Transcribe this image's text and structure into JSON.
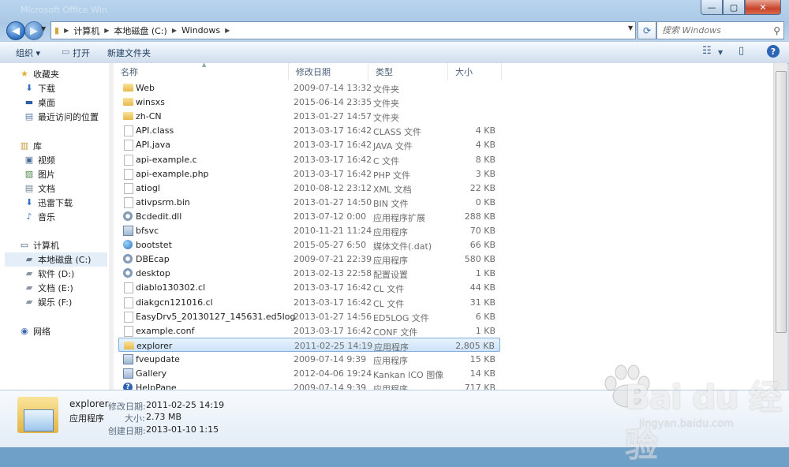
{
  "window": {
    "title_ghost": "Microsoft Office Win",
    "min": "—",
    "max": "▢",
    "close": "✕"
  },
  "address": {
    "segments": [
      "计算机",
      "本地磁盘 (C:)",
      "Windows"
    ]
  },
  "search": {
    "placeholder": "搜索 Windows"
  },
  "toolbar": {
    "organize": "组织 ▾",
    "open": "打开",
    "new_folder": "新建文件夹",
    "help": "?"
  },
  "sidebar": {
    "favorites": "收藏夹",
    "fav_items": [
      "下载",
      "桌面",
      "最近访问的位置"
    ],
    "library": "库",
    "lib_items": [
      "视频",
      "图片",
      "文档",
      "迅雷下载",
      "音乐"
    ],
    "computer": "计算机",
    "drives": [
      "本地磁盘 (C:)",
      "软件 (D:)",
      "文档 (E:)",
      "娱乐 (F:)"
    ],
    "network": "网络"
  },
  "columns": {
    "name": "名称",
    "date": "修改日期",
    "type": "类型",
    "size": "大小"
  },
  "files": [
    {
      "name": "Web",
      "date": "2009-07-14 13:32",
      "type": "文件夹",
      "size": "",
      "icon": "folder"
    },
    {
      "name": "winsxs",
      "date": "2015-06-14 23:35",
      "type": "文件夹",
      "size": "",
      "icon": "folder"
    },
    {
      "name": "zh-CN",
      "date": "2013-01-27 14:57",
      "type": "文件夹",
      "size": "",
      "icon": "folder"
    },
    {
      "name": "API.class",
      "date": "2013-03-17 16:42",
      "type": "CLASS 文件",
      "size": "4 KB",
      "icon": "file"
    },
    {
      "name": "API.java",
      "date": "2013-03-17 16:42",
      "type": "JAVA 文件",
      "size": "4 KB",
      "icon": "file"
    },
    {
      "name": "api-example.c",
      "date": "2013-03-17 16:42",
      "type": "C 文件",
      "size": "8 KB",
      "icon": "file"
    },
    {
      "name": "api-example.php",
      "date": "2013-03-17 16:42",
      "type": "PHP 文件",
      "size": "3 KB",
      "icon": "file"
    },
    {
      "name": "atiogl",
      "date": "2010-08-12 23:12",
      "type": "XML 文档",
      "size": "22 KB",
      "icon": "file"
    },
    {
      "name": "ativpsrm.bin",
      "date": "2013-01-27 14:50",
      "type": "BIN 文件",
      "size": "0 KB",
      "icon": "file"
    },
    {
      "name": "Bcdedit.dll",
      "date": "2013-07-12 0:00",
      "type": "应用程序扩展",
      "size": "288 KB",
      "icon": "gear"
    },
    {
      "name": "bfsvc",
      "date": "2010-11-21 11:24",
      "type": "应用程序",
      "size": "70 KB",
      "icon": "app"
    },
    {
      "name": "bootstet",
      "date": "2015-05-27 6:50",
      "type": "媒体文件(.dat)",
      "size": "66 KB",
      "icon": "globe"
    },
    {
      "name": "DBEcap",
      "date": "2009-07-21 22:39",
      "type": "应用程序",
      "size": "580 KB",
      "icon": "gear"
    },
    {
      "name": "desktop",
      "date": "2013-02-13 22:58",
      "type": "配置设置",
      "size": "1 KB",
      "icon": "gear"
    },
    {
      "name": "diablo130302.cl",
      "date": "2013-03-17 16:42",
      "type": "CL 文件",
      "size": "44 KB",
      "icon": "file"
    },
    {
      "name": "diakgcn121016.cl",
      "date": "2013-03-17 16:42",
      "type": "CL 文件",
      "size": "31 KB",
      "icon": "file"
    },
    {
      "name": "EasyDrv5_20130127_145631.ed5log",
      "date": "2013-01-27 14:56",
      "type": "ED5LOG 文件",
      "size": "6 KB",
      "icon": "file"
    },
    {
      "name": "example.conf",
      "date": "2013-03-17 16:42",
      "type": "CONF 文件",
      "size": "1 KB",
      "icon": "file"
    },
    {
      "name": "explorer",
      "date": "2011-02-25 14:19",
      "type": "应用程序",
      "size": "2,805 KB",
      "icon": "folder",
      "selected": true
    },
    {
      "name": "fveupdate",
      "date": "2009-07-14 9:39",
      "type": "应用程序",
      "size": "15 KB",
      "icon": "app"
    },
    {
      "name": "Gallery",
      "date": "2012-04-06 19:24",
      "type": "Kankan ICO 图像",
      "size": "14 KB",
      "icon": "app"
    },
    {
      "name": "HelpPane",
      "date": "2009-07-14 9:39",
      "type": "应用程序",
      "size": "717 KB",
      "icon": "help"
    }
  ],
  "details": {
    "name": "explorer",
    "type": "应用程序",
    "modified_label": "修改日期:",
    "modified": "2011-02-25 14:19",
    "size_label": "大小:",
    "size": "2.73 MB",
    "created_label": "创建日期:",
    "created": "2013-01-10 1:15"
  },
  "watermark": {
    "brand": "Bai du 经验",
    "url": "jingyan.baidu.com"
  }
}
